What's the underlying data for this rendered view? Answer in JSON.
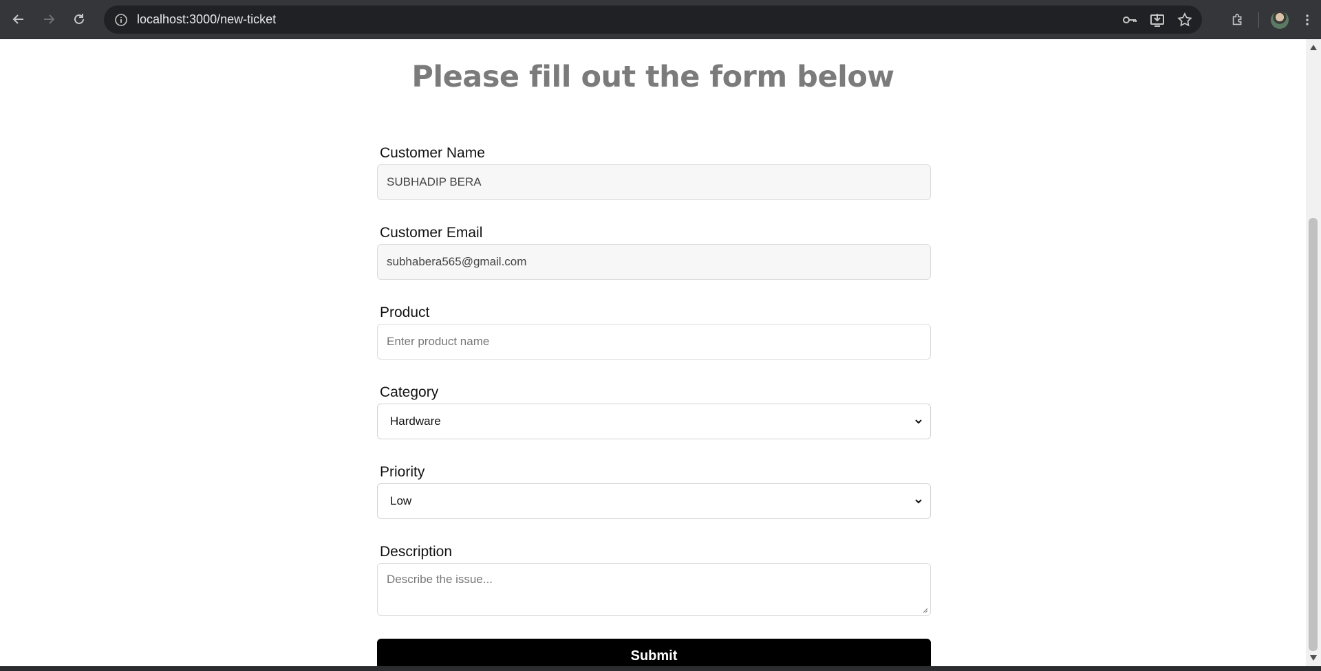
{
  "browser": {
    "url": "localhost:3000/new-ticket",
    "icons": {
      "back": "arrow-left-icon",
      "forward": "arrow-right-icon",
      "reload": "reload-icon",
      "info": "info-icon",
      "passwords": "key-icon",
      "install": "install-app-icon",
      "bookmark": "star-icon",
      "extensions": "puzzle-icon",
      "profile": "avatar",
      "menu": "kebab-menu-icon"
    }
  },
  "page": {
    "title": "Please fill out the form below"
  },
  "form": {
    "customer_name": {
      "label": "Customer Name",
      "value": "SUBHADIP BERA"
    },
    "customer_email": {
      "label": "Customer Email",
      "value": "subhabera565@gmail.com"
    },
    "product": {
      "label": "Product",
      "placeholder": "Enter product name"
    },
    "category": {
      "label": "Category",
      "selected": "Hardware"
    },
    "priority": {
      "label": "Priority",
      "selected": "Low"
    },
    "description": {
      "label": "Description",
      "placeholder": "Describe the issue..."
    },
    "submit_label": "Submit"
  },
  "colors": {
    "title": "#7b7b7b",
    "submit_bg": "#000000",
    "chrome_bg": "#35363a"
  }
}
